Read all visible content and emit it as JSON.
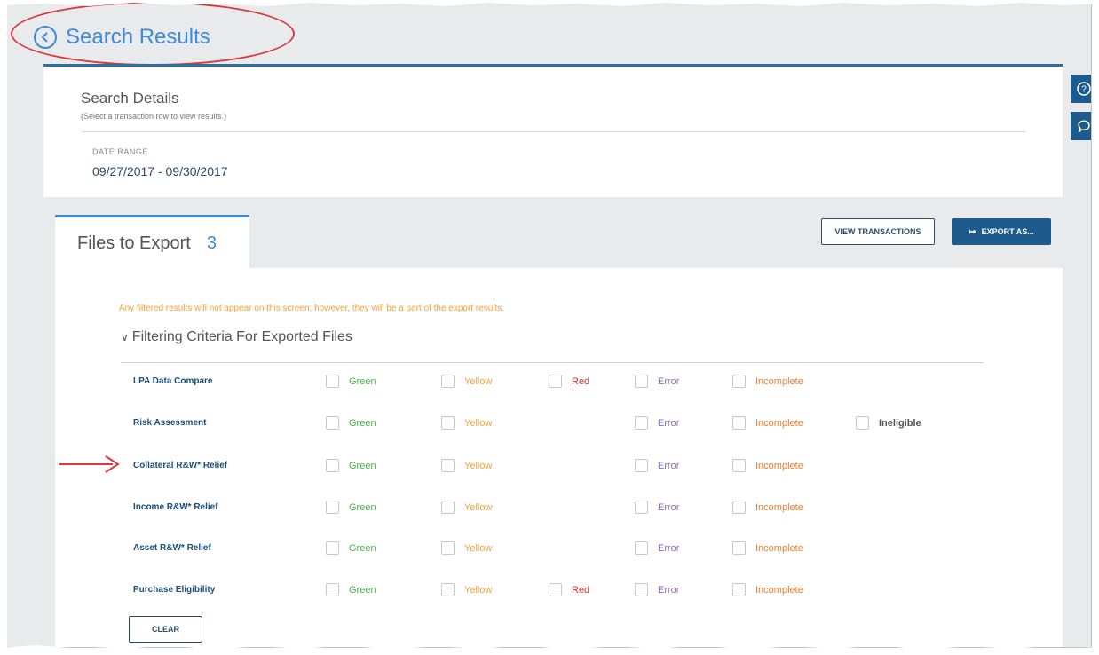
{
  "header": {
    "title": "Search Results"
  },
  "details": {
    "title": "Search Details",
    "subtitle": "(Select a transaction row to view results.)",
    "date_label": "DATE RANGE",
    "date_value": "09/27/2017 - 09/30/2017"
  },
  "tab": {
    "label": "Files to Export",
    "count": "3"
  },
  "actions": {
    "view_transactions": "VIEW TRANSACTIONS",
    "export_as": "EXPORT AS..."
  },
  "notice": "Any filtered results will not appear on this screen; however, they will be a part of the export results.",
  "filter": {
    "title": "Filtering Criteria For Exported Files",
    "rows": [
      {
        "label": "LPA Data Compare",
        "options": [
          "Green",
          "Yellow",
          "Red",
          "Error",
          "Incomplete"
        ]
      },
      {
        "label": "Risk Assessment",
        "options": [
          "Green",
          "Yellow",
          "Error",
          "Incomplete",
          "Ineligible"
        ]
      },
      {
        "label": "Collateral R&W* Relief",
        "options": [
          "Green",
          "Yellow",
          "Error",
          "Incomplete"
        ]
      },
      {
        "label": "Income R&W* Relief",
        "options": [
          "Green",
          "Yellow",
          "Error",
          "Incomplete"
        ]
      },
      {
        "label": "Asset R&W* Relief",
        "options": [
          "Green",
          "Yellow",
          "Error",
          "Incomplete"
        ]
      },
      {
        "label": "Purchase Eligibility",
        "options": [
          "Green",
          "Yellow",
          "Red",
          "Error",
          "Incomplete"
        ]
      }
    ],
    "clear": "CLEAR"
  },
  "colors": {
    "accent": "#3f8bd6",
    "primary": "#1d5b8c",
    "annotation": "#d83a3a"
  }
}
